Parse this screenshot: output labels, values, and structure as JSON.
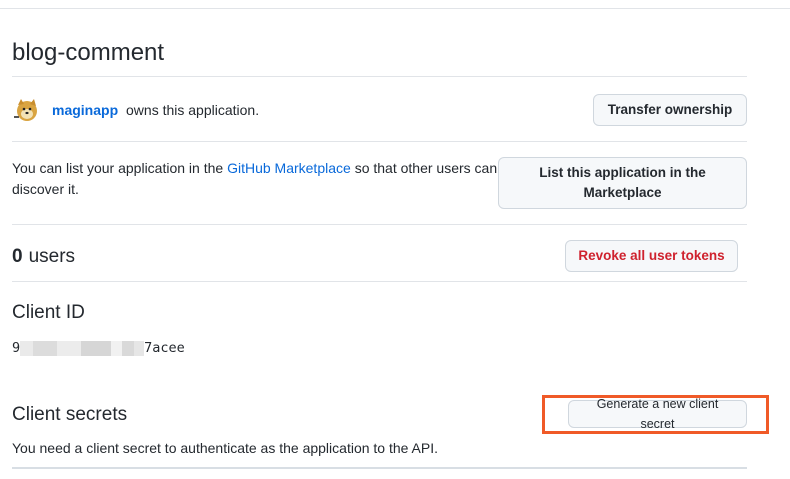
{
  "app": {
    "title": "blog-comment"
  },
  "owner": {
    "name": "maginapp",
    "suffix": "owns this application.",
    "transfer_button": "Transfer ownership"
  },
  "marketplace": {
    "text_before": "You can list your application in the",
    "link": "GitHub Marketplace",
    "text_after": "so that other users can discover it.",
    "button": "List this application in the Marketplace"
  },
  "users": {
    "count": "0",
    "label": "users",
    "revoke_button": "Revoke all user tokens"
  },
  "client_id": {
    "heading": "Client ID",
    "prefix": "9",
    "suffix": "7acee"
  },
  "client_secrets": {
    "heading": "Client secrets",
    "generate_button": "Generate a new client secret",
    "description": "You need a client secret to authenticate as the application to the API."
  },
  "colors": {
    "link": "#0969da",
    "danger": "#cf222e",
    "highlight": "#f05a28",
    "button_bg": "#f6f8fa",
    "border": "#e1e4e8"
  }
}
